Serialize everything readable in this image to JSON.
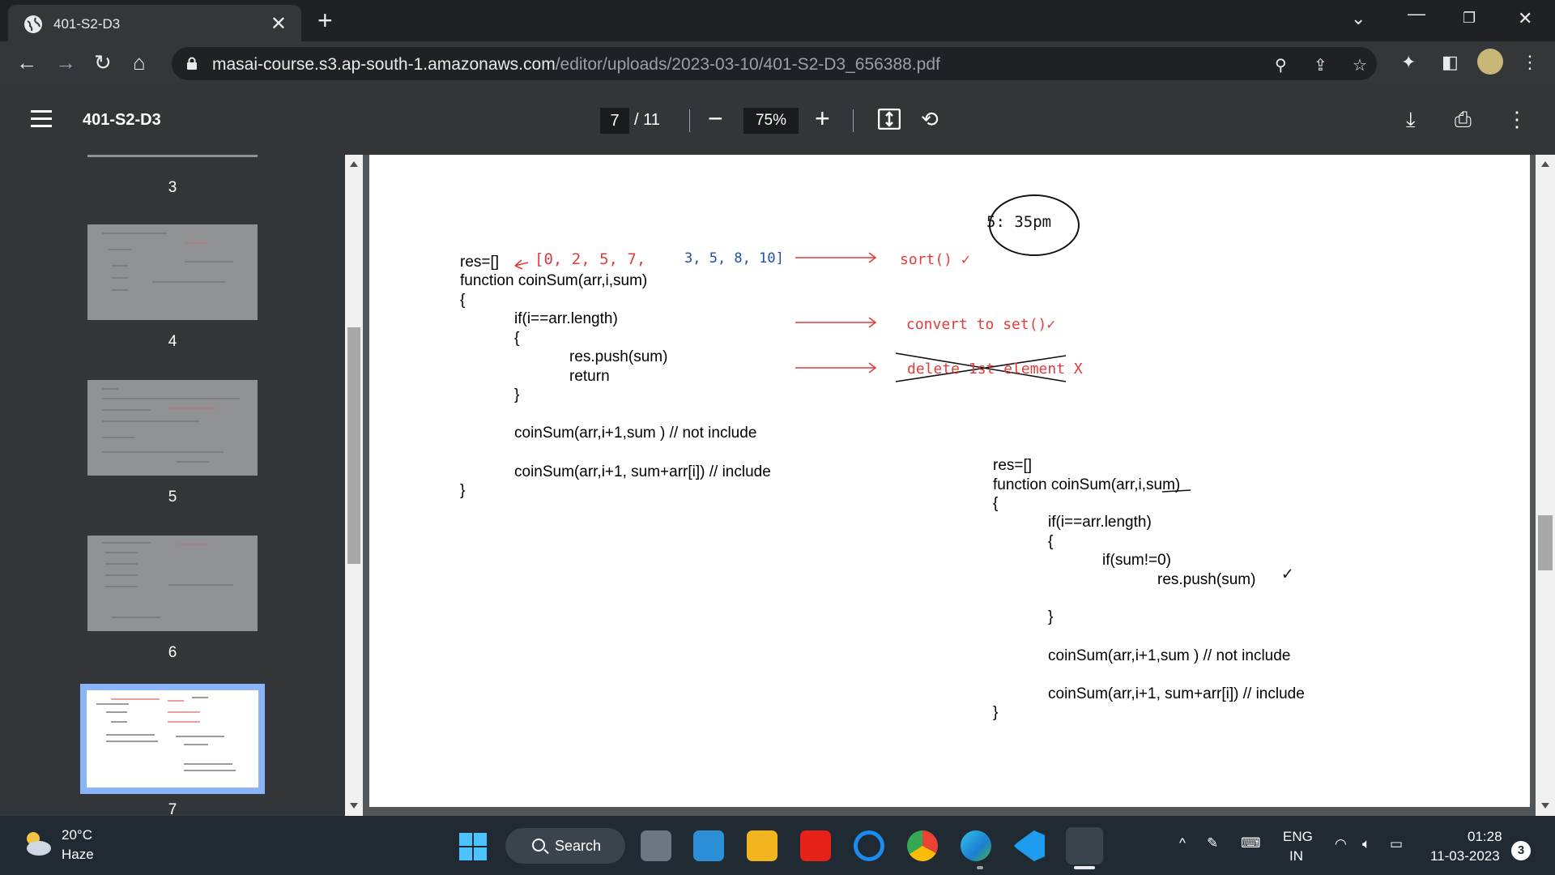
{
  "browser": {
    "tab_title": "401-S2-D3",
    "url_host": "masai-course.s3.ap-south-1.amazonaws.com",
    "url_path": "/editor/uploads/2023-03-10/401-S2-D3_656388.pdf"
  },
  "pdf_toolbar": {
    "doc_title": "401-S2-D3",
    "current_page": "7",
    "total_pages": "/ 11",
    "zoom": "75%"
  },
  "sidebar": {
    "page_labels": [
      "3",
      "4",
      "5",
      "6",
      "7"
    ],
    "selected_page": "7"
  },
  "page": {
    "left_code": [
      "res=[]",
      "function coinSum(arr,i,sum)",
      "{",
      "if(i==arr.length)",
      "{",
      "res.push(sum)",
      "return",
      "}",
      "coinSum(arr,i+1,sum ) // not include",
      "coinSum(arr,i+1, sum+arr[i]) // include",
      "}"
    ],
    "right_code": [
      "res=[]",
      "function coinSum(arr,i,sum)",
      "{",
      "if(i==arr.length)",
      "{",
      "if(sum!=0)",
      "res.push(sum)",
      "}",
      "coinSum(arr,i+1,sum ) // not include",
      "coinSum(arr,i+1, sum+arr[i]) // include",
      "}"
    ],
    "annotations": {
      "time": "5: 35pm",
      "array_red": "[0, 2, 5, 7,",
      "array_blue": "3, 5, 8, 10]",
      "note_sort": "sort() ✓",
      "note_set": "convert to set()✓",
      "note_delete": "delete 1st element X",
      "check": "✓"
    }
  },
  "taskbar": {
    "temperature": "20°C",
    "weather": "Haze",
    "search_label": "Search",
    "lang_top": "ENG",
    "lang_bottom": "IN",
    "time": "01:28",
    "date": "11-03-2023",
    "notifications": "3"
  },
  "colors": {
    "annotation_red": "#e23b3b",
    "annotation_blue": "#1f4fa8",
    "selected_thumb_border": "#8ab4f8"
  }
}
